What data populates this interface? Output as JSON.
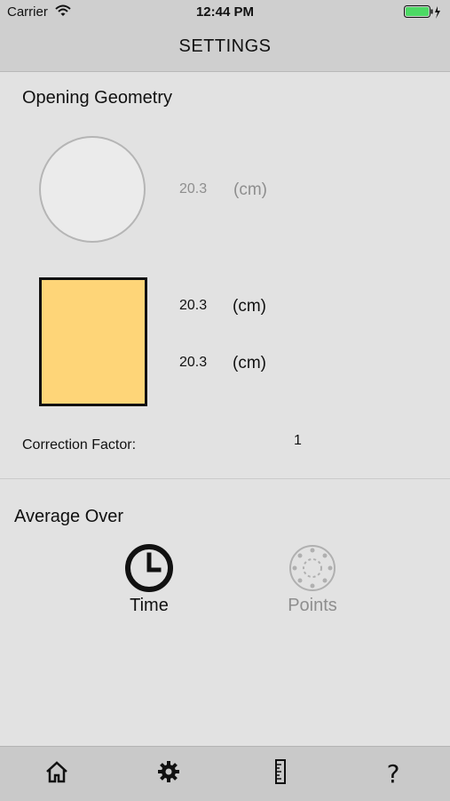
{
  "status_bar": {
    "carrier": "Carrier",
    "time": "12:44 PM",
    "wifi_icon": "wifi-icon",
    "battery_icon": "battery-charging-icon",
    "battery_color": "#4cd964"
  },
  "nav": {
    "title": "SETTINGS"
  },
  "opening_geometry": {
    "title": "Opening Geometry",
    "circle": {
      "diameter": "20.3",
      "unit": "(cm)",
      "active": false
    },
    "rectangle": {
      "width": "20.3",
      "width_unit": "(cm)",
      "height": "20.3",
      "height_unit": "(cm)",
      "active": true,
      "fill_color": "#fed578"
    },
    "correction_factor_label": "Correction Factor:",
    "correction_factor_value": "1"
  },
  "average_over": {
    "title": "Average Over",
    "options": [
      {
        "label": "Time",
        "icon": "clock-icon",
        "selected": true
      },
      {
        "label": "Points",
        "icon": "points-icon",
        "selected": false
      }
    ]
  },
  "tab_bar": {
    "items": [
      {
        "icon": "home-icon"
      },
      {
        "icon": "gear-icon"
      },
      {
        "icon": "ruler-icon"
      },
      {
        "icon": "help-icon",
        "glyph": "?"
      }
    ]
  }
}
